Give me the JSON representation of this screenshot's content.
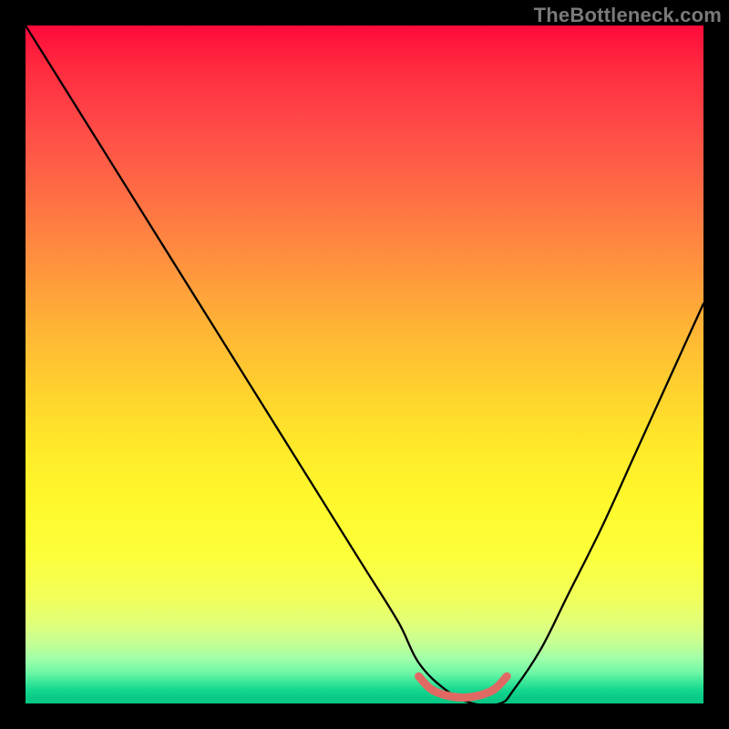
{
  "watermark": "TheBottleneck.com",
  "chart_data": {
    "type": "line",
    "title": "",
    "xlabel": "",
    "ylabel": "",
    "xlim": [
      0,
      100
    ],
    "ylim": [
      0,
      100
    ],
    "background": {
      "kind": "vertical-gradient",
      "stops": [
        {
          "pos": 0,
          "color": "#ff0a3a"
        },
        {
          "pos": 50,
          "color": "#ffd22e"
        },
        {
          "pos": 85,
          "color": "#f2ff57"
        },
        {
          "pos": 100,
          "color": "#06c783"
        }
      ],
      "meaning": "top = high bottleneck %, bottom = 0%"
    },
    "series": [
      {
        "name": "bottleneck-curve",
        "color": "#000000",
        "x": [
          0,
          5,
          10,
          15,
          20,
          25,
          30,
          35,
          40,
          45,
          50,
          55,
          58,
          62,
          66,
          70,
          72,
          76,
          80,
          85,
          90,
          95,
          100
        ],
        "y": [
          100,
          92,
          84,
          76,
          68,
          60,
          52,
          44,
          36,
          28,
          20,
          12,
          6,
          2,
          0,
          0,
          2,
          8,
          16,
          26,
          37,
          48,
          59
        ]
      },
      {
        "name": "optimal-range-marker",
        "color": "#e26a63",
        "style": "thick",
        "x": [
          58,
          60,
          63,
          66,
          69,
          71
        ],
        "y": [
          4,
          2,
          1,
          1,
          2,
          4
        ]
      }
    ],
    "annotations": []
  }
}
